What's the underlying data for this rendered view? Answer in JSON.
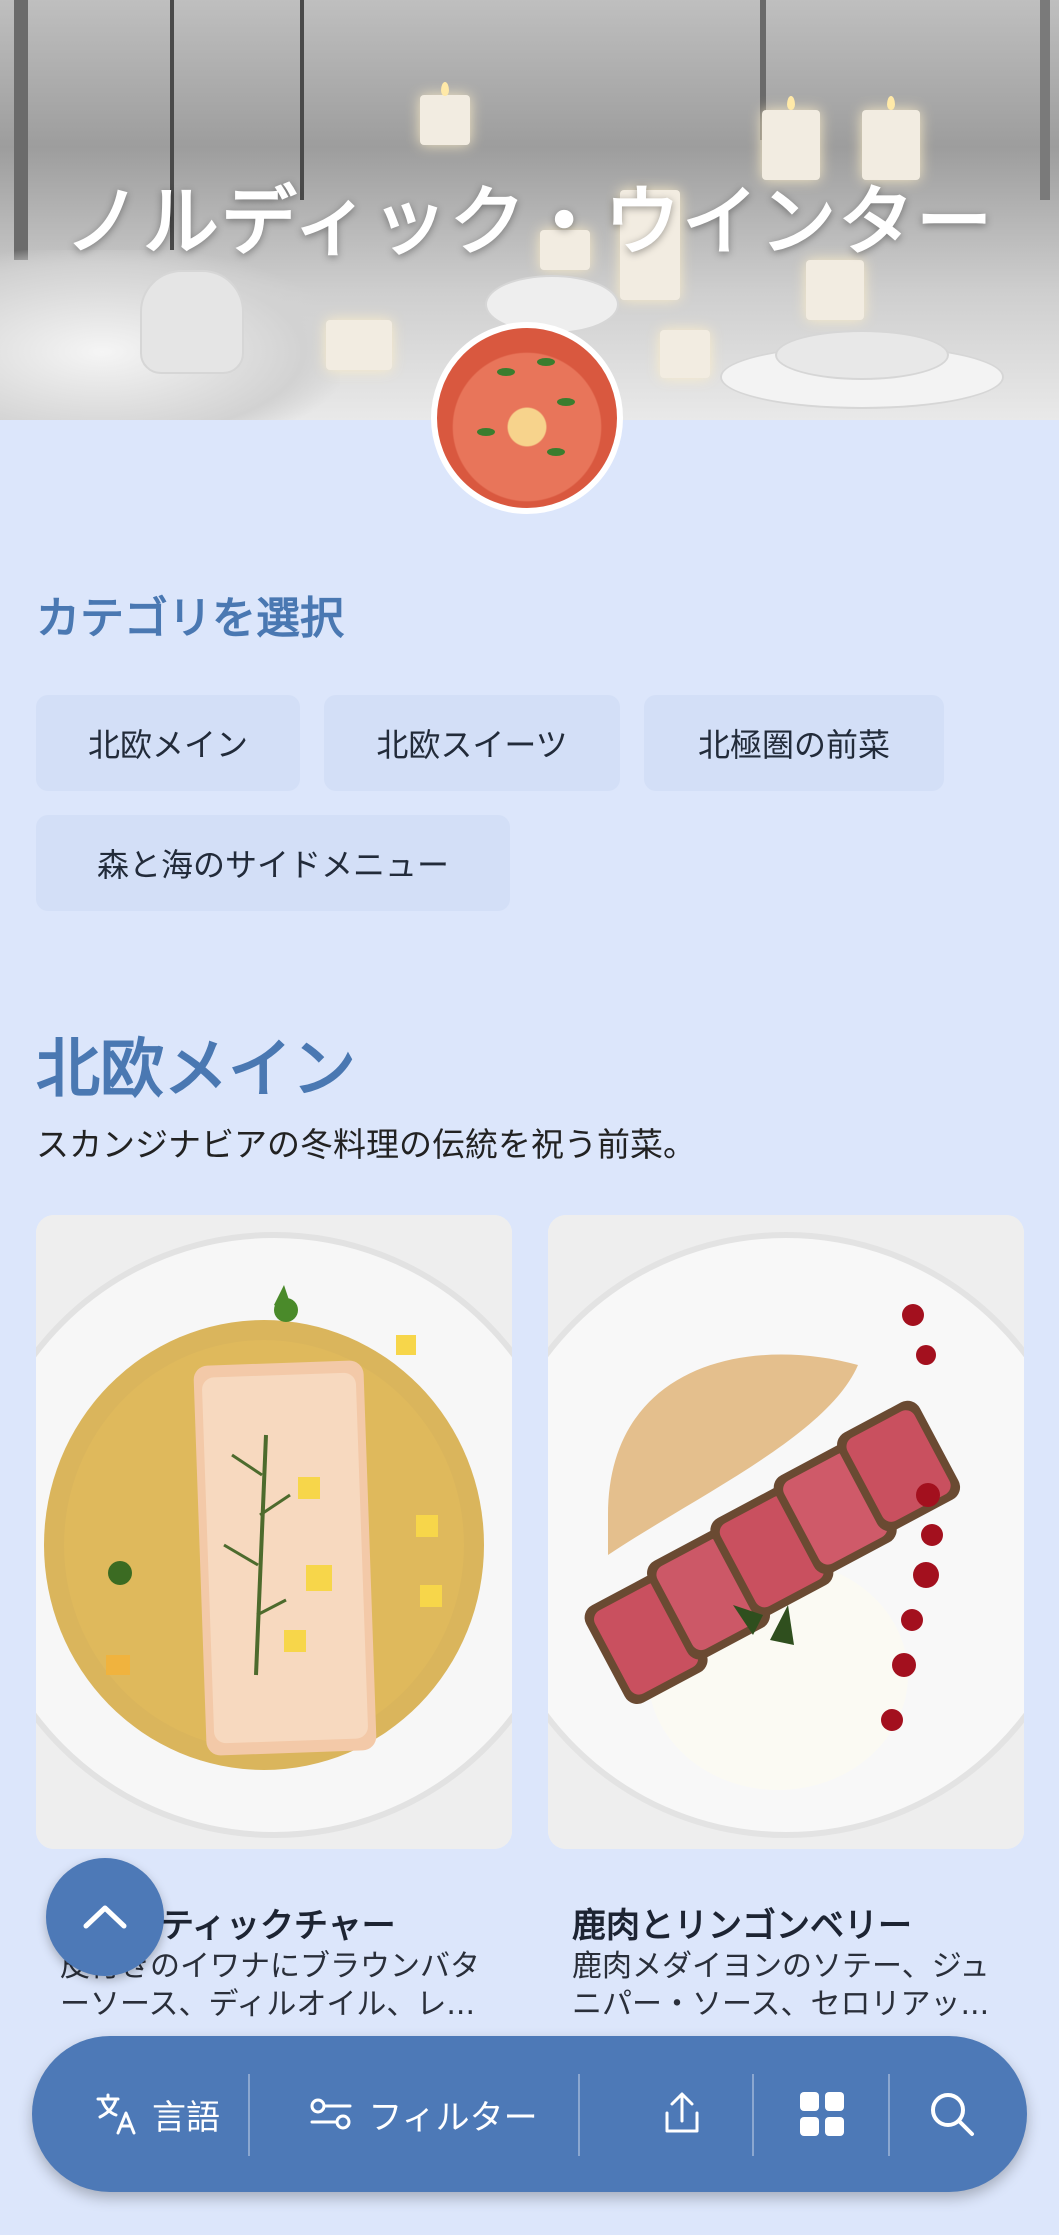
{
  "hero": {
    "title": "ノルディック・ウインター"
  },
  "category_select": {
    "label": "カテゴリを選択",
    "chips": [
      "北欧メイン",
      "北欧スイーツ",
      "北極圏の前菜",
      "森と海のサイドメニュー"
    ]
  },
  "section": {
    "title": "北欧メイン",
    "description": "スカンジナビアの冬料理の伝統を祝う前菜。"
  },
  "cards": [
    {
      "title": "ティックチャー",
      "description": "皮付きのイワナにブラウンバターソース、ディルオイル、レ..."
    },
    {
      "title": "鹿肉とリンゴンベリー",
      "description": "鹿肉メダイヨンのソテー、ジュニパー・ソース、セロリアッ..."
    }
  ],
  "bottom_bar": {
    "language_label": "言語",
    "filter_label": "フィルター",
    "icons": [
      "translate-icon",
      "filter-icon",
      "share-icon",
      "grid-icon",
      "search-icon"
    ]
  },
  "colors": {
    "accent": "#4a78b2",
    "bar": "#4d79b7",
    "background": "#dce6fb",
    "chip": "#d3dff7"
  }
}
